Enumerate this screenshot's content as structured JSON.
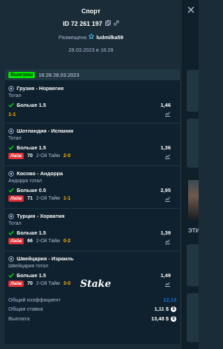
{
  "header": {
    "title": "Спорт",
    "bet_id": "ID 72 261 197",
    "placed_label": "Размещена",
    "username": "ludmilka59",
    "date": "28.03.2023 в 16:28"
  },
  "card": {
    "status_badge": "Выиграш",
    "date": "16:28 28.03.2023"
  },
  "legs": [
    {
      "teams": "Грузия - Норвегия",
      "market": "Тотал",
      "selection": "Больше 1.5",
      "odds": "1,46",
      "score": "1-1",
      "live": null,
      "minute": null,
      "period": null
    },
    {
      "teams": "Шотландия - Испания",
      "market": "Тотал",
      "selection": "Больше 1.5",
      "odds": "1,36",
      "score": "2-0",
      "live": "Лайв",
      "minute": "70",
      "period": "2-Ой Тайм"
    },
    {
      "teams": "Косово - Андорра",
      "market": "Андорра тотал",
      "selection": "Больше 0.5",
      "odds": "2,95",
      "score": "1-1",
      "live": "Лайв",
      "minute": "71",
      "period": "2-Ой Тайм"
    },
    {
      "teams": "Турция - Хорватия",
      "market": "Тотал",
      "selection": "Больше 1.5",
      "odds": "1,39",
      "score": "0-2",
      "live": "Лайв",
      "minute": "66",
      "period": "2-Ой Тайм"
    },
    {
      "teams": "Швейцария - Израиль",
      "market": "Швейцария тотал",
      "selection": "Больше 1.5",
      "odds": "1,49",
      "score": "3-0",
      "live": "Лайв",
      "minute": "70",
      "period": "2-Ой Тайм"
    }
  ],
  "brand": "Stake",
  "summary": {
    "total_odds_label": "Общий коэффициент",
    "total_odds": "12,13",
    "total_stake_label": "Общая ставка",
    "total_stake": "1,11 $",
    "payout_label": "Выплата",
    "payout": "13,48 $"
  },
  "sidebar": {
    "partial_text": "ЭТИ"
  },
  "colors": {
    "background": "#1a2c38",
    "card": "#0f212e",
    "won": "#00e701",
    "live": "#e03036",
    "score": "#ffb300",
    "accent_blue": "#1475e1",
    "check": "#00e701"
  }
}
